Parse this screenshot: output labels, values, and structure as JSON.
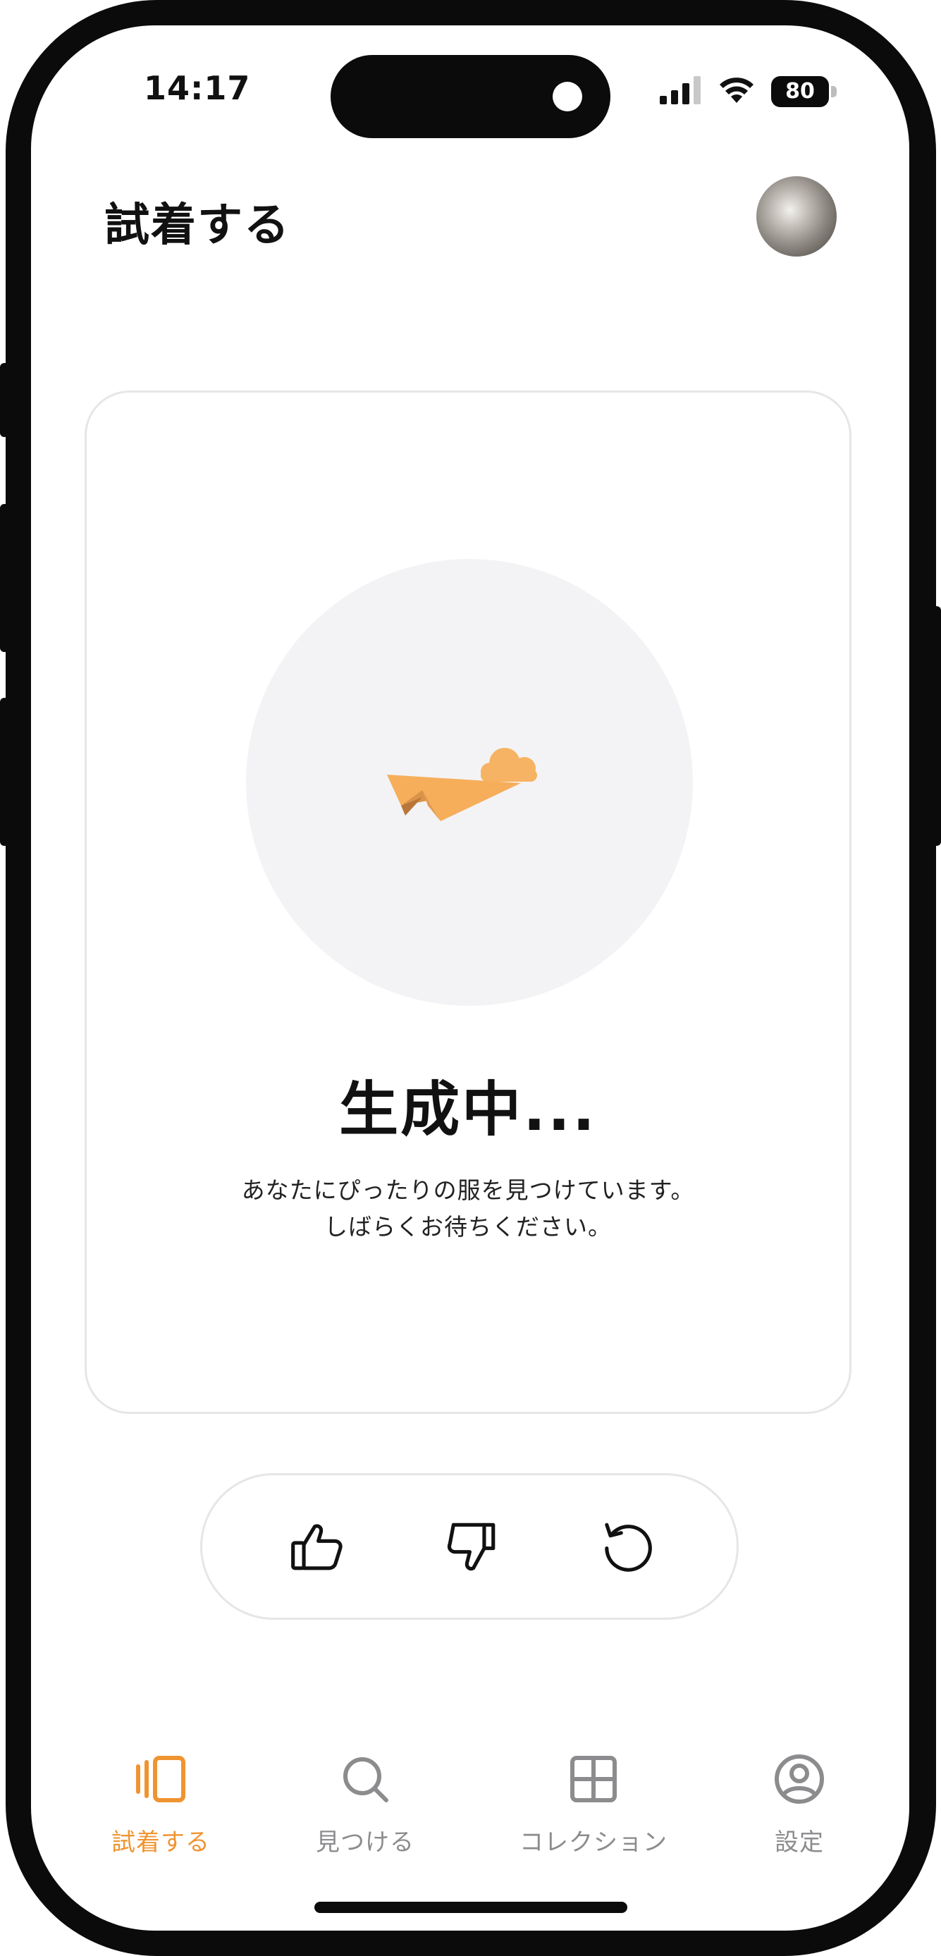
{
  "status_bar": {
    "time": "14:17",
    "battery": "80"
  },
  "header": {
    "title": "試着する"
  },
  "generation": {
    "title": "生成中...",
    "line1": "あなたにぴったりの服を見つけています。",
    "line2": "しばらくお待ちください。"
  },
  "feedback": {
    "like_icon": "thumbs-up-icon",
    "dislike_icon": "thumbs-down-icon",
    "retry_icon": "refresh-icon"
  },
  "tabbar": {
    "tabs": [
      {
        "label": "試着する",
        "icon": "try-on-cards-icon",
        "active": true
      },
      {
        "label": "見つける",
        "icon": "search-icon",
        "active": false
      },
      {
        "label": "コレクション",
        "icon": "grid-icon",
        "active": false
      },
      {
        "label": "設定",
        "icon": "profile-circle-icon",
        "active": false
      }
    ]
  },
  "colors": {
    "accent": "#ef9431",
    "inactive": "#8c8c8f",
    "plane": "#f6ae5b",
    "cloud": "#f6b363",
    "circle_bg": "#f3f3f5",
    "border": "#e6e6e8"
  }
}
